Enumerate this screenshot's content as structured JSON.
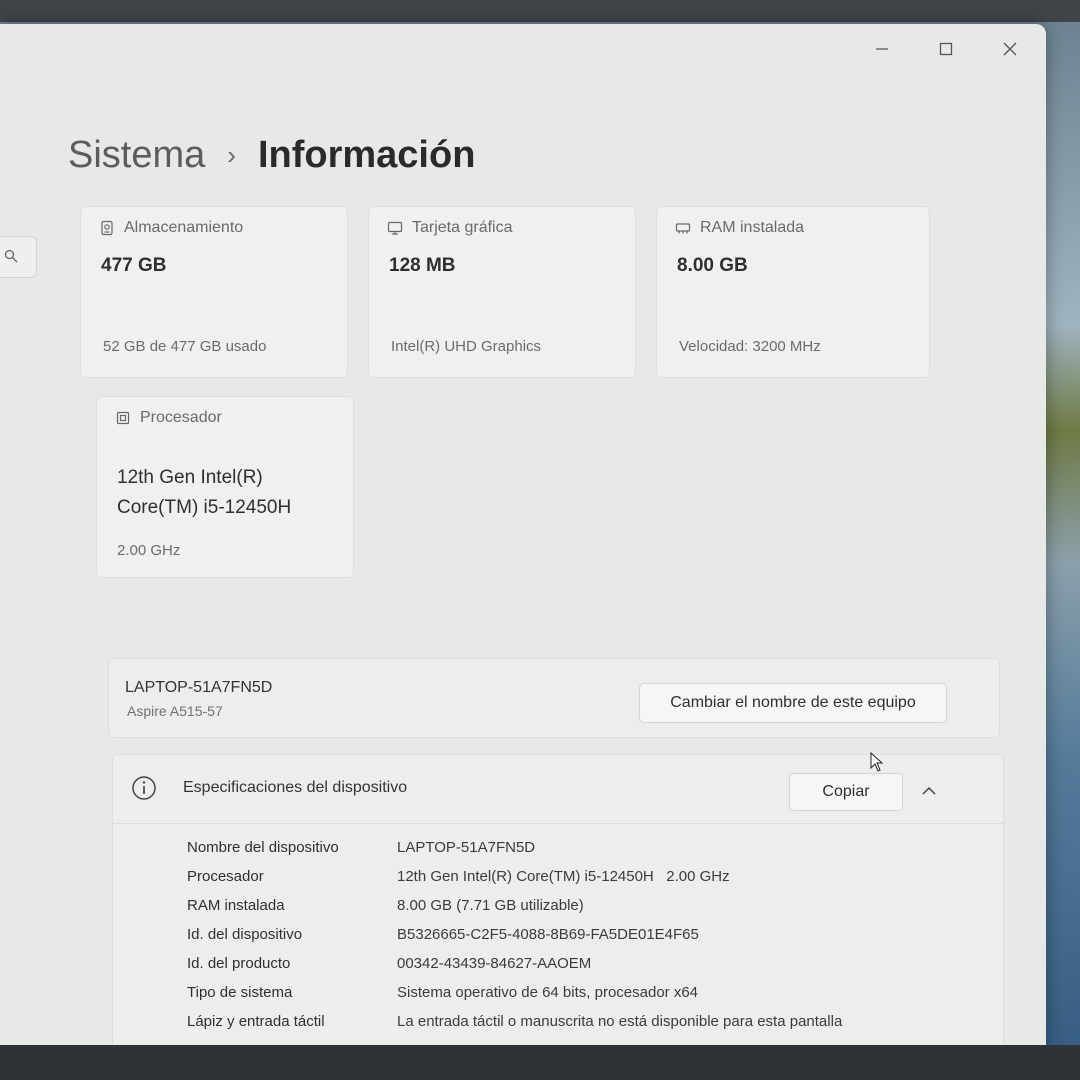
{
  "breadcrumb": {
    "parent": "Sistema",
    "separator": "›",
    "current": "Información"
  },
  "window_controls": {
    "minimize_icon": "minimize-icon",
    "maximize_icon": "maximize-icon",
    "close_icon": "close-icon"
  },
  "cards": {
    "storage": {
      "icon": "storage-icon",
      "title": "Almacenamiento",
      "value": "477 GB",
      "sub": "52 GB de 477 GB usado"
    },
    "gpu": {
      "icon": "graphics-card-icon",
      "title": "Tarjeta gráfica",
      "value": "128 MB",
      "sub": "Intel(R) UHD Graphics"
    },
    "ram": {
      "icon": "ram-icon",
      "title": "RAM instalada",
      "value": "8.00 GB",
      "sub": "Velocidad: 3200 MHz"
    },
    "cpu": {
      "icon": "processor-icon",
      "title": "Procesador",
      "value_line1": "12th Gen Intel(R)",
      "value_line2": "Core(TM) i5-12450H",
      "sub": "2.00 GHz"
    }
  },
  "device": {
    "name": "LAPTOP-51A7FN5D",
    "model": "Aspire A515-57",
    "rename_label": "Cambiar el nombre de este equipo"
  },
  "specs": {
    "title": "Especificaciones del dispositivo",
    "copy_label": "Copiar",
    "rows": [
      {
        "label": "Nombre del dispositivo",
        "value": "LAPTOP-51A7FN5D"
      },
      {
        "label": "Procesador",
        "value": "12th Gen Intel(R) Core(TM) i5-12450H   2.00 GHz"
      },
      {
        "label": "RAM instalada",
        "value": "8.00 GB (7.71 GB utilizable)"
      },
      {
        "label": "Id. del dispositivo",
        "value": "B5326665-C2F5-4088-8B69-FA5DE01E4F65"
      },
      {
        "label": "Id. del producto",
        "value": "00342-43439-84627-AAOEM"
      },
      {
        "label": "Tipo de sistema",
        "value": "Sistema operativo de 64 bits, procesador x64"
      },
      {
        "label": "Lápiz y entrada táctil",
        "value": "La entrada táctil o manuscrita no está disponible para esta pantalla"
      }
    ]
  },
  "colors": {
    "window_bg": "#e7e9e7",
    "card_bg": "#eff1ef",
    "text_primary": "#2f2f2f",
    "text_secondary": "#6b6b6b"
  }
}
